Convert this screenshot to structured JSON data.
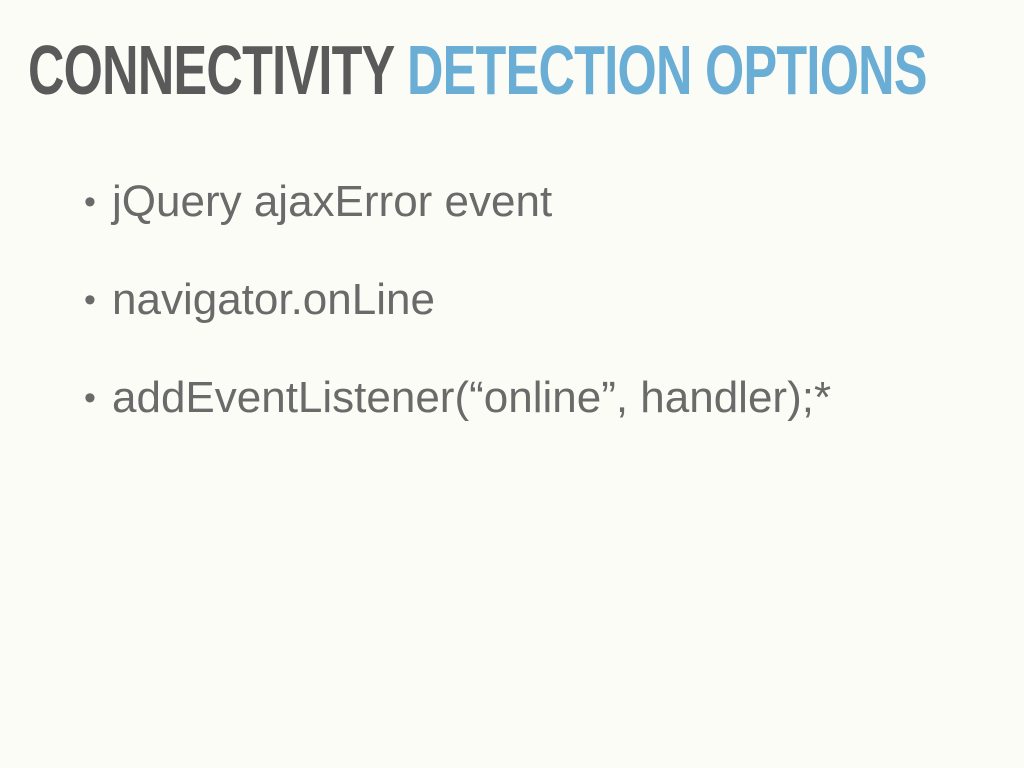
{
  "slide": {
    "title_part1": "CONNECTIVITY",
    "title_part2": "DETECTION OPTIONS",
    "bullet_glyph": "•",
    "bullets": [
      "jQuery ajaxError event",
      "navigator.onLine",
      "addEventListener(“online”, handler);*"
    ],
    "colors": {
      "background": "#fcfcf7",
      "title_dark": "#5a5a5a",
      "title_accent": "#6aaed6",
      "body_text": "#6a6a6a"
    }
  }
}
